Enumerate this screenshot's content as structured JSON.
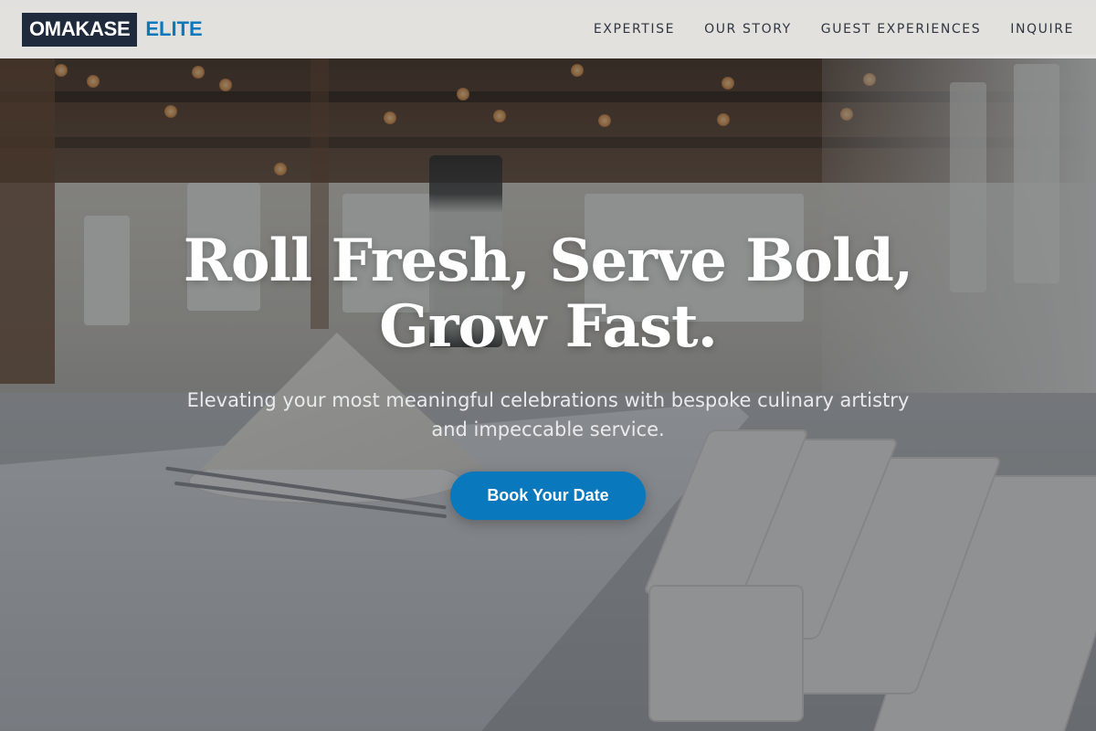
{
  "brand": {
    "name_primary": "OMAKASE",
    "name_accent": "ELITE",
    "colors": {
      "logo_box": "#1f2a3c",
      "accent": "#0a78bd"
    }
  },
  "nav": {
    "items": [
      {
        "label": "EXPERTISE"
      },
      {
        "label": "OUR STORY"
      },
      {
        "label": "GUEST EXPERIENCES"
      },
      {
        "label": "INQUIRE"
      }
    ]
  },
  "hero": {
    "title_line1": "Roll Fresh, Serve Bold,",
    "title_line2": "Grow Fast.",
    "subtitle_line1": "Elevating your most meaningful celebrations with bespoke culinary artistry",
    "subtitle_line2": "and impeccable service.",
    "cta_label": "Book Your Date",
    "cta_color": "#0a78bd",
    "background_image": "banquet-table-photo"
  }
}
